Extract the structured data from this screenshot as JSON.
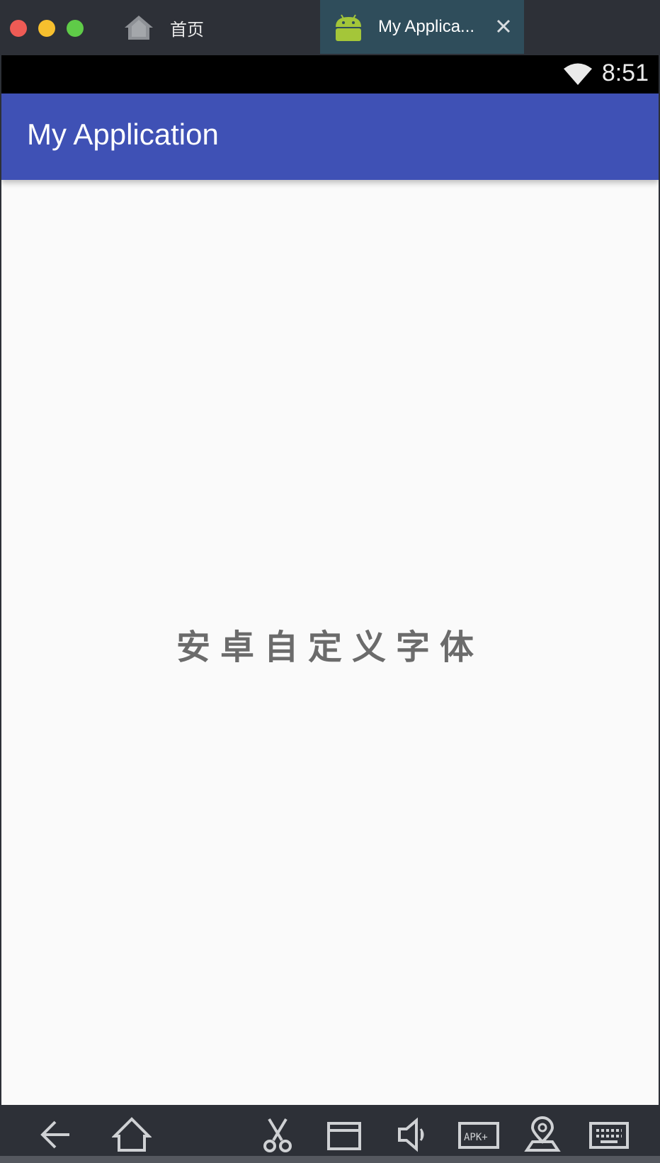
{
  "window": {
    "tabs": [
      {
        "label": "首页",
        "icon": "home-icon",
        "active": false
      },
      {
        "label": "My Applica...",
        "icon": "android-icon",
        "active": true
      }
    ]
  },
  "statusbar": {
    "time": "8:51",
    "wifi_icon": "wifi-icon"
  },
  "app": {
    "title": "My Application",
    "center_text": "安卓自定义字体"
  },
  "navbar": {
    "buttons": [
      "back-icon",
      "home-icon",
      "screenshot-cut-icon",
      "folder-icon",
      "volume-icon",
      "apk-install-icon",
      "location-icon",
      "keyboard-icon"
    ]
  },
  "colors": {
    "appbar": "#3f51b5",
    "chrome": "#2d3037",
    "active_tab": "#2f4d5b",
    "content_bg": "#fafafa",
    "center_text": "#6b6b6b"
  }
}
